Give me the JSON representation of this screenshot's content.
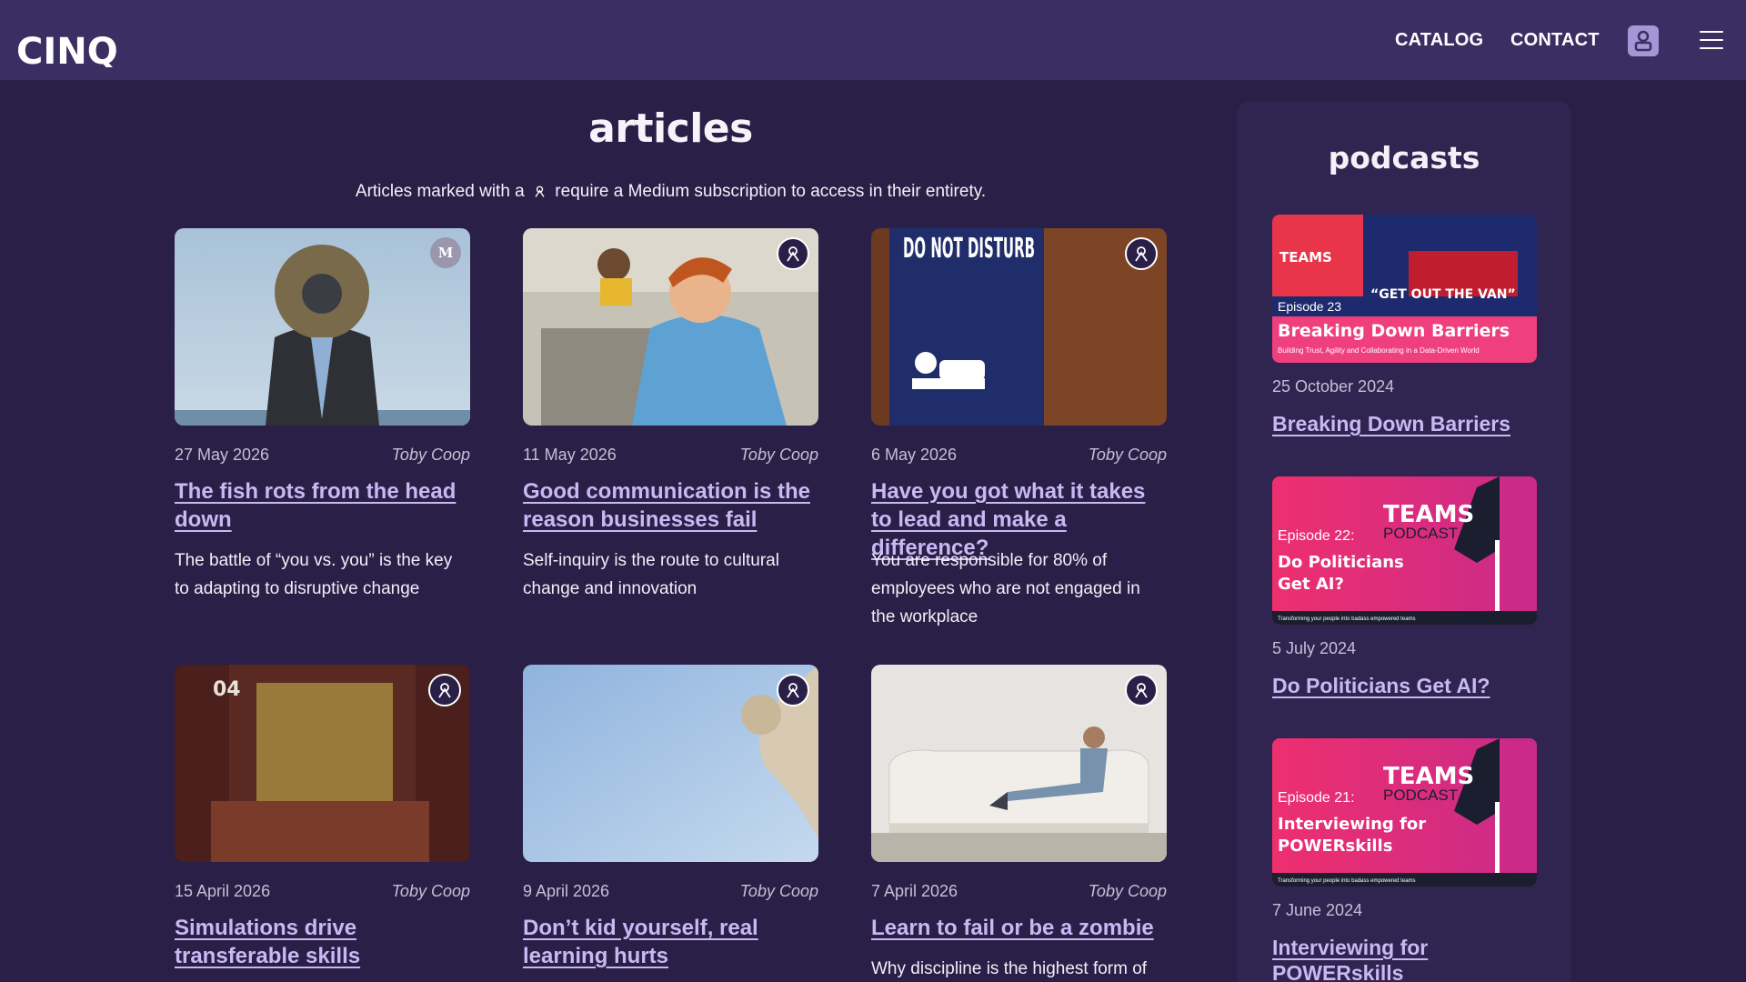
{
  "header": {
    "logo_text": "CINQ",
    "nav": {
      "catalog": "CATALOG",
      "contact": "CONTACT"
    }
  },
  "articles": {
    "title": "articles",
    "intro_before": "Articles marked with a",
    "intro_after": "require a Medium subscription to access in their entirety.",
    "items": [
      {
        "date": "27 May 2026",
        "author": "Toby Coop",
        "title": "The fish rots from the head down",
        "description": "The battle of “you vs. you” is the key to adapting to disruptive change",
        "badge": "M"
      },
      {
        "date": "11 May 2026",
        "author": "Toby Coop",
        "title": "Good communication is the reason businesses fail",
        "description": "Self-inquiry is the route to cultural change and innovation"
      },
      {
        "date": "6 May 2026",
        "author": "Toby Coop",
        "title": "Have you got what it takes to lead and make a difference?",
        "description": "You are responsible for 80% of employees who are not engaged in the workplace",
        "image_text": "DO NOT DISTURB"
      },
      {
        "date": "15 April 2026",
        "author": "Toby Coop",
        "title": "Simulations drive transferable skills",
        "description": "",
        "image_text": "04"
      },
      {
        "date": "9 April 2026",
        "author": "Toby Coop",
        "title": "Don’t kid yourself, real learning hurts",
        "description": ""
      },
      {
        "date": "7 April 2026",
        "author": "Toby Coop",
        "title": "Learn to fail or be a zombie",
        "description": "Why discipline is the highest form of"
      }
    ]
  },
  "podcasts": {
    "title": "podcasts",
    "items": [
      {
        "date": "25 October 2024",
        "title": "Breaking Down Barriers",
        "art": {
          "episode": "Episode 23",
          "quote": "“GET OUT THE VAN”",
          "headline": "Breaking Down Barriers",
          "sub": "Building Trust, Agility and Collaborating in a Data-Driven World",
          "brand": "TEAMS"
        }
      },
      {
        "date": "5 July 2024",
        "title": "Do Politicians Get AI?",
        "art": {
          "episode": "Episode 22:",
          "headline1": "Do Politicians",
          "headline2": "Get AI?",
          "brand": "TEAMS",
          "brand_sub": "PODCAST",
          "tagline": "Transforming your people into badass empowered teams"
        }
      },
      {
        "date": "7 June 2024",
        "title": "Interviewing for POWERskills",
        "art": {
          "episode": "Episode 21:",
          "headline1": "Interviewing for",
          "headline2": "POWERskills",
          "brand": "TEAMS",
          "brand_sub": "PODCAST",
          "tagline": "Transforming your people into badass empowered teams"
        }
      }
    ]
  },
  "colors": {
    "background": "#2a1f47",
    "header": "#3b2e62",
    "link": "#c9b8f2",
    "podcast_panel": "#2f2550"
  },
  "icons": {
    "medium_member": "medium-member-icon",
    "user": "user-icon",
    "menu": "hamburger-icon"
  }
}
